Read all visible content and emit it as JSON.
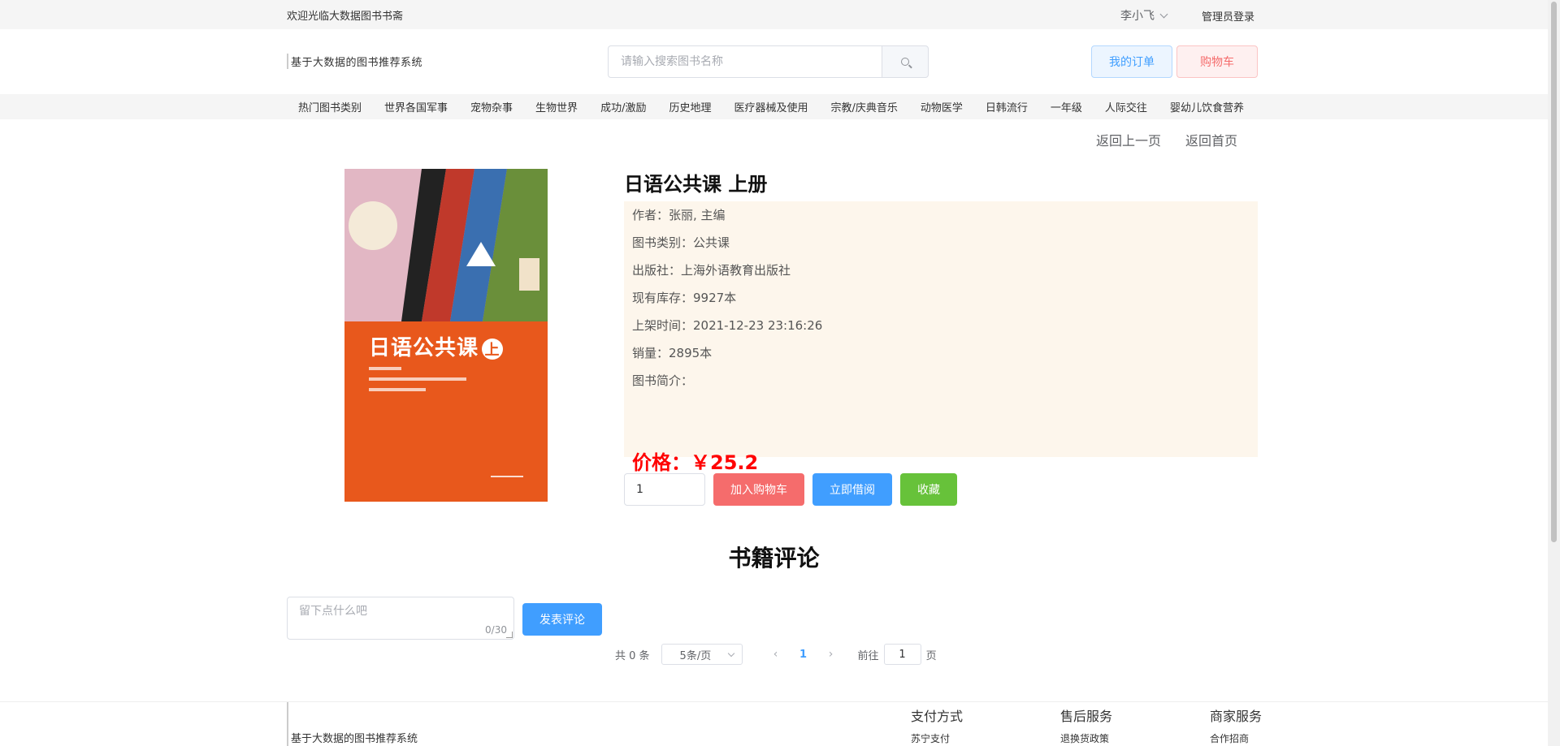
{
  "topbar": {
    "welcome": "欢迎光临大数据图书书斋",
    "user": "李小飞",
    "admin_login": "管理员登录"
  },
  "header": {
    "logo": "基于大数据的图书推荐系统",
    "search_placeholder": "请输入搜索图书名称",
    "my_orders": "我的订单",
    "cart": "购物车"
  },
  "categories": [
    "热门图书类别",
    "世界各国军事",
    "宠物杂事",
    "生物世界",
    "成功/激励",
    "历史地理",
    "医疗器械及使用",
    "宗教/庆典音乐",
    "动物医学",
    "日韩流行",
    "一年级",
    "人际交往",
    "婴幼儿饮食营养"
  ],
  "nav": {
    "back": "返回上一页",
    "home": "返回首页"
  },
  "cover": {
    "title": "日语公共课",
    "volume": "上"
  },
  "book": {
    "title": "日语公共课 上册",
    "author": "作者：张丽, 主编",
    "category": "图书类别：公共课",
    "publisher": "出版社：上海外语教育出版社",
    "stock": "现有库存：9927本",
    "listed": "上架时间：2021-12-23 23:16:26",
    "sales": "销量：2895本",
    "intro": "图书简介：",
    "price": "价格：￥25.2"
  },
  "actions": {
    "quantity": "1",
    "add_cart": "加入购物车",
    "borrow": "立即借阅",
    "favorite": "收藏"
  },
  "reviews": {
    "title": "书籍评论",
    "placeholder": "留下点什么吧",
    "counter": "0/30",
    "post": "发表评论"
  },
  "pagination": {
    "total": "共 0 条",
    "page_size": "5条/页",
    "prev": "‹",
    "current": "1",
    "next": "›",
    "goto_label": "前往",
    "goto_value": "1",
    "page_suffix": "页"
  },
  "footer": {
    "logo": "基于大数据的图书推荐系统",
    "columns": [
      {
        "title": "支付方式",
        "item": "苏宁支付"
      },
      {
        "title": "售后服务",
        "item": "退换货政策"
      },
      {
        "title": "商家服务",
        "item": "合作招商"
      }
    ]
  }
}
